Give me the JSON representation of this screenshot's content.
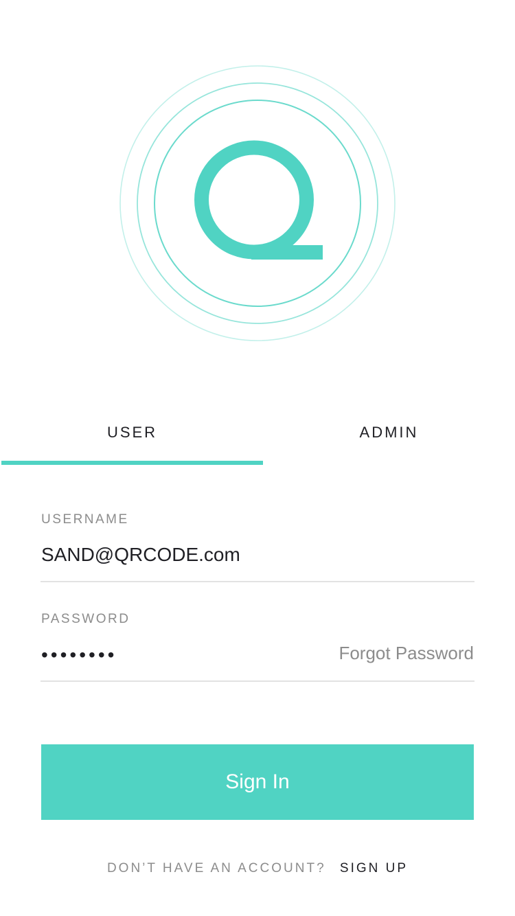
{
  "brand": {
    "logo_letter": "Q",
    "accent_color": "#50d3c3"
  },
  "tabs": [
    {
      "label": "USER",
      "active": true
    },
    {
      "label": "ADMIN",
      "active": false
    }
  ],
  "form": {
    "username": {
      "label": "USERNAME",
      "value": "SAND@QRCODE.com"
    },
    "password": {
      "label": "PASSWORD",
      "value": "password",
      "forgot_label": "Forgot Password"
    },
    "submit_label": "Sign In"
  },
  "footer": {
    "prompt": "DON’T HAVE AN ACCOUNT?",
    "signup_label": "SIGN UP"
  }
}
